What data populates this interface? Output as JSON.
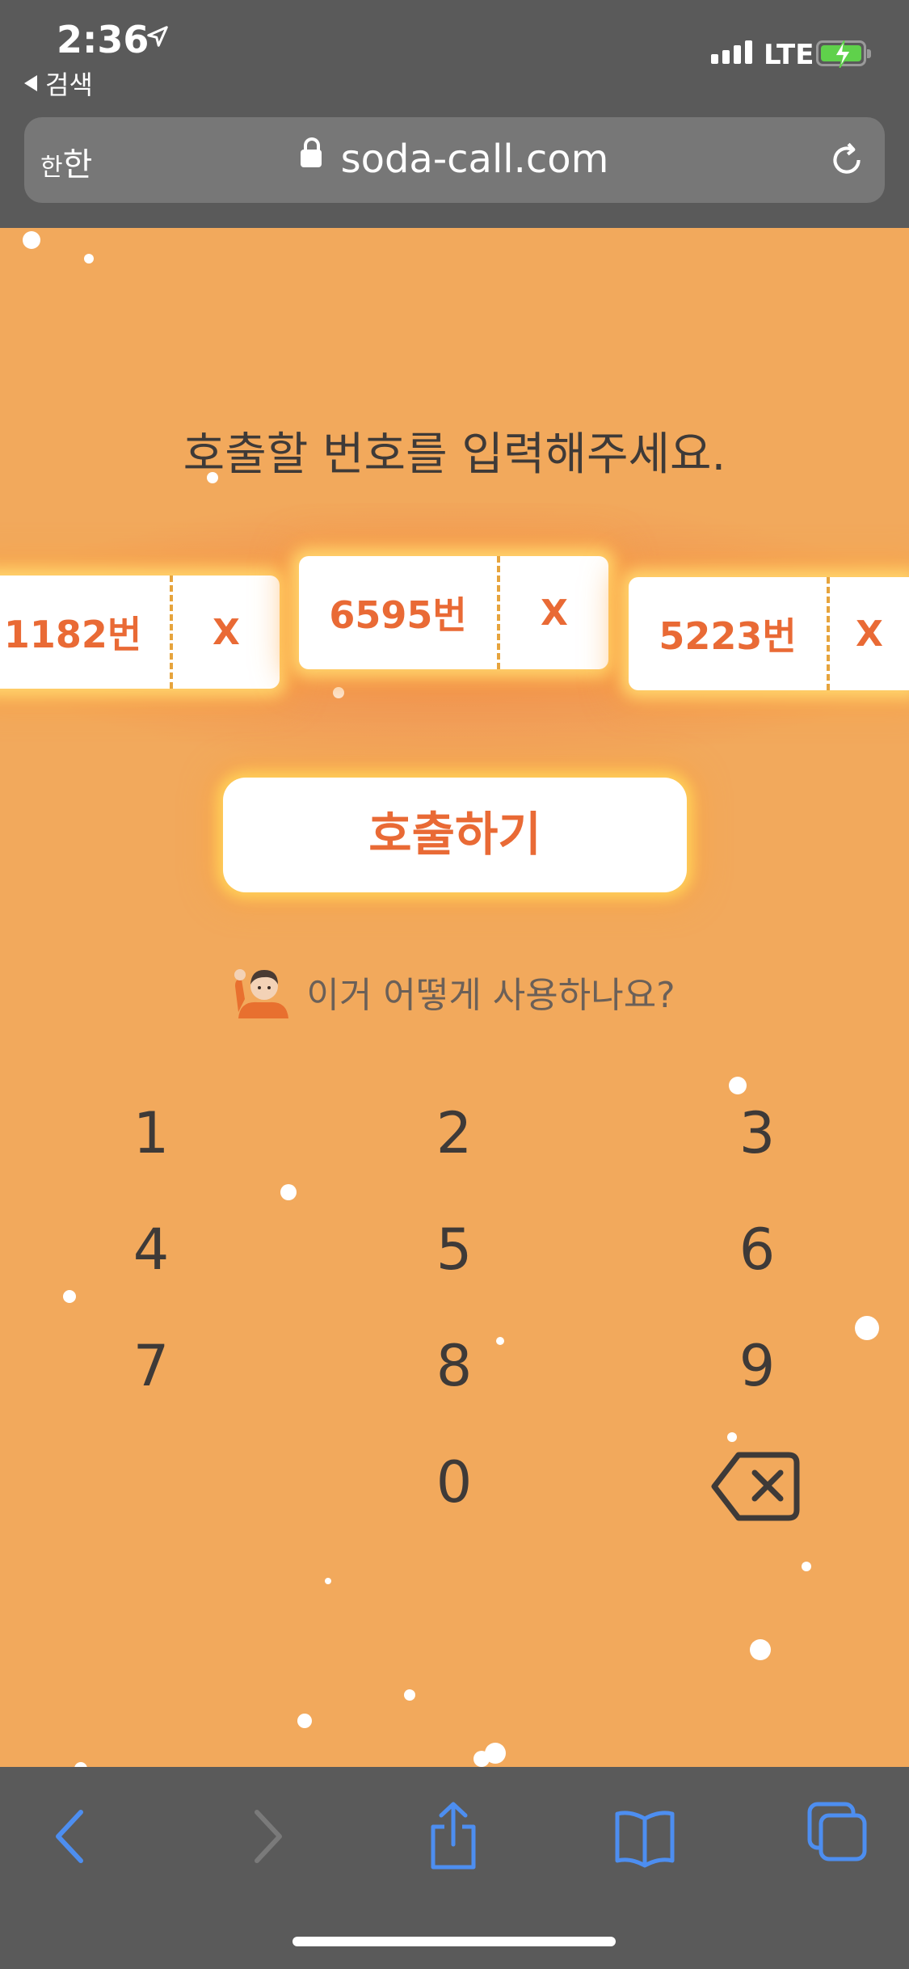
{
  "status_bar": {
    "time": "2:36",
    "back_label": "검색",
    "network": "LTE"
  },
  "browser": {
    "text_size_label_small": "한",
    "text_size_label_large": "한",
    "url": "soda-call.com"
  },
  "page": {
    "headline": "호출할 번호를 입력해주세요.",
    "tickets": [
      {
        "number": "1182번",
        "remove": "X"
      },
      {
        "number": "6595번",
        "remove": "X"
      },
      {
        "number": "5223번",
        "remove": "X"
      }
    ],
    "call_button": "호출하기",
    "help_link": "이거 어떻게 사용하나요?",
    "keypad": [
      "1",
      "2",
      "3",
      "4",
      "5",
      "6",
      "7",
      "8",
      "9",
      "0"
    ]
  },
  "colors": {
    "background": "#f2a95c",
    "accent": "#e96a35",
    "browser_chrome": "#5a5a5a",
    "toolbar_icon": "#4d8ef0"
  },
  "icons": [
    "location-arrow-icon",
    "signal-icon",
    "battery-charging-icon",
    "lock-icon",
    "reload-icon",
    "waving-person-icon",
    "backspace-icon",
    "back-icon",
    "forward-icon",
    "share-icon",
    "bookmarks-icon",
    "tabs-icon"
  ]
}
